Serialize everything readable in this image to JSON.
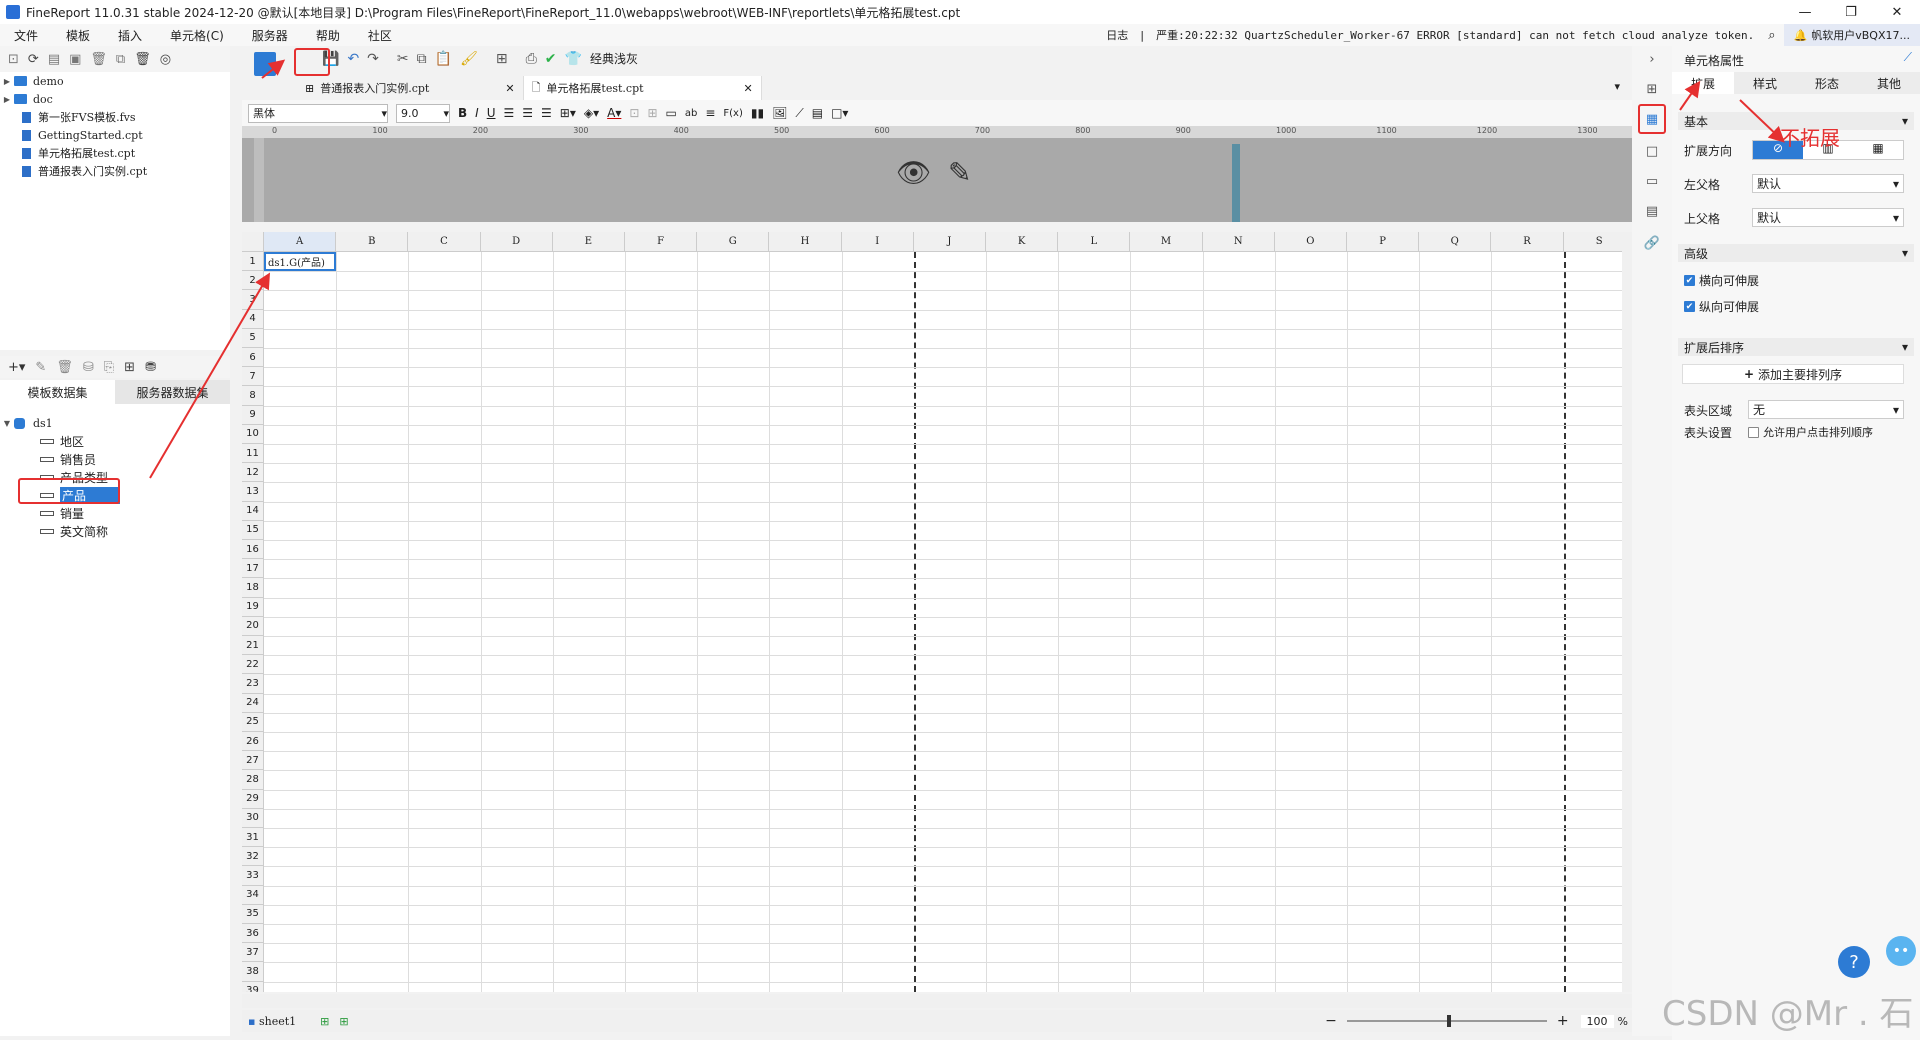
{
  "titlebar": {
    "text": "FineReport 11.0.31 stable 2024-12-20 @默认[本地目录]   D:\\Program Files\\FineReport\\FineReport_11.0\\webapps\\webroot\\WEB-INF\\reportlets\\单元格拓展test.cpt",
    "min": "—",
    "max": "❐",
    "close": "✕"
  },
  "menu": {
    "items": [
      "文件",
      "模板",
      "插入",
      "单元格(C)",
      "服务器",
      "帮助",
      "社区"
    ],
    "log_label": "日志",
    "log_text": "严重:20:22:32 QuartzScheduler_Worker-67 ERROR [standard] can not fetch cloud analyze token.",
    "user": "帆软用户vBQX17..."
  },
  "filetree": {
    "items": [
      {
        "label": "demo",
        "type": "folder"
      },
      {
        "label": "doc",
        "type": "folder"
      },
      {
        "label": "第一张FVS模板.fvs",
        "type": "file"
      },
      {
        "label": "GettingStarted.cpt",
        "type": "file"
      },
      {
        "label": "单元格拓展test.cpt",
        "type": "file"
      },
      {
        "label": "普通报表入门实例.cpt",
        "type": "file"
      }
    ]
  },
  "datasets": {
    "tab_template": "模板数据集",
    "tab_server": "服务器数据集",
    "root": "ds1",
    "fields": [
      "地区",
      "销售员",
      "产品类型",
      "产品",
      "销量",
      "英文简称"
    ],
    "selected": "产品"
  },
  "toolbar": {
    "theme_label": "经典浅灰",
    "tabs": [
      "普通报表入门实例.cpt",
      "单元格拓展test.cpt"
    ]
  },
  "format": {
    "font": "黑体",
    "size": "9.0"
  },
  "ruler": {
    "marks": [
      "0",
      "100",
      "200",
      "300",
      "400",
      "500",
      "600",
      "700",
      "800",
      "900",
      "1000",
      "1100",
      "1200",
      "1300"
    ]
  },
  "grid": {
    "columns": [
      "A",
      "B",
      "C",
      "D",
      "E",
      "F",
      "G",
      "H",
      "I",
      "J",
      "K",
      "L",
      "M",
      "N",
      "O",
      "P",
      "Q",
      "R",
      "S"
    ],
    "rows": [
      "1",
      "2",
      "3",
      "4",
      "5",
      "6",
      "7",
      "8",
      "9",
      "10",
      "11",
      "12",
      "13",
      "14",
      "15",
      "16",
      "17",
      "18",
      "19",
      "20",
      "21",
      "22",
      "23",
      "24",
      "25",
      "26",
      "27",
      "28",
      "29",
      "30",
      "31",
      "32",
      "33",
      "34",
      "35",
      "36",
      "37",
      "38",
      "39"
    ],
    "cell_A1": "ds1.G(产品)"
  },
  "sheet": {
    "name": "sheet1",
    "zoom": "100",
    "zoom_unit": "%"
  },
  "props": {
    "header": "单元格属性",
    "tabs": [
      "扩展",
      "样式",
      "形态",
      "其他"
    ],
    "sec_basic": "基本",
    "expand_dir_label": "扩展方向",
    "left_parent_label": "左父格",
    "left_parent_value": "默认",
    "top_parent_label": "上父格",
    "top_parent_value": "默认",
    "sec_advanced": "高级",
    "chk_horizontal": "横向可伸展",
    "chk_vertical": "纵向可伸展",
    "sec_sort": "扩展后排序",
    "add_sort": "添加主要排列序",
    "header_area_label": "表头区域",
    "header_area_value": "无",
    "header_setting_label": "表头设置",
    "header_setting_chk": "允许用户点击排列顺序"
  },
  "annotation": {
    "text": "不拓展"
  },
  "watermark": "CSDN @Mr . 石"
}
